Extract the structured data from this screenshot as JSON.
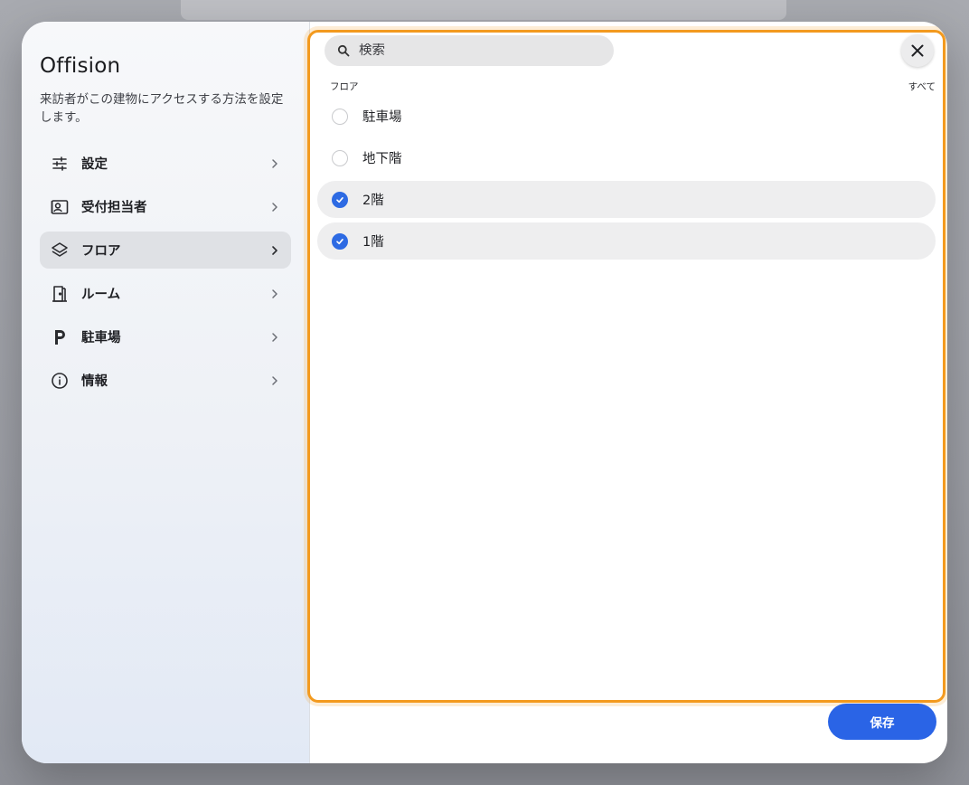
{
  "app": {
    "title": "Offision",
    "description": "来訪者がこの建物にアクセスする方法を設定します。"
  },
  "sidebar": {
    "items": [
      {
        "label": "設定",
        "icon": "sliders-icon",
        "active": false
      },
      {
        "label": "受付担当者",
        "icon": "contact-card-icon",
        "active": false
      },
      {
        "label": "フロア",
        "icon": "layers-icon",
        "active": true
      },
      {
        "label": "ルーム",
        "icon": "door-icon",
        "active": false
      },
      {
        "label": "駐車場",
        "icon": "parking-icon",
        "active": false
      },
      {
        "label": "情報",
        "icon": "info-icon",
        "active": false
      }
    ]
  },
  "panel": {
    "search": {
      "placeholder": "検索",
      "value": ""
    },
    "section_label": "フロア",
    "select_all_label": "すべて",
    "floors": [
      {
        "label": "駐車場",
        "selected": false
      },
      {
        "label": "地下階",
        "selected": false
      },
      {
        "label": "2階",
        "selected": true
      },
      {
        "label": "1階",
        "selected": true
      }
    ]
  },
  "footer": {
    "save_label": "保存"
  },
  "colors": {
    "accent": "#2a64e6",
    "focus_outline": "#f39a1e"
  }
}
